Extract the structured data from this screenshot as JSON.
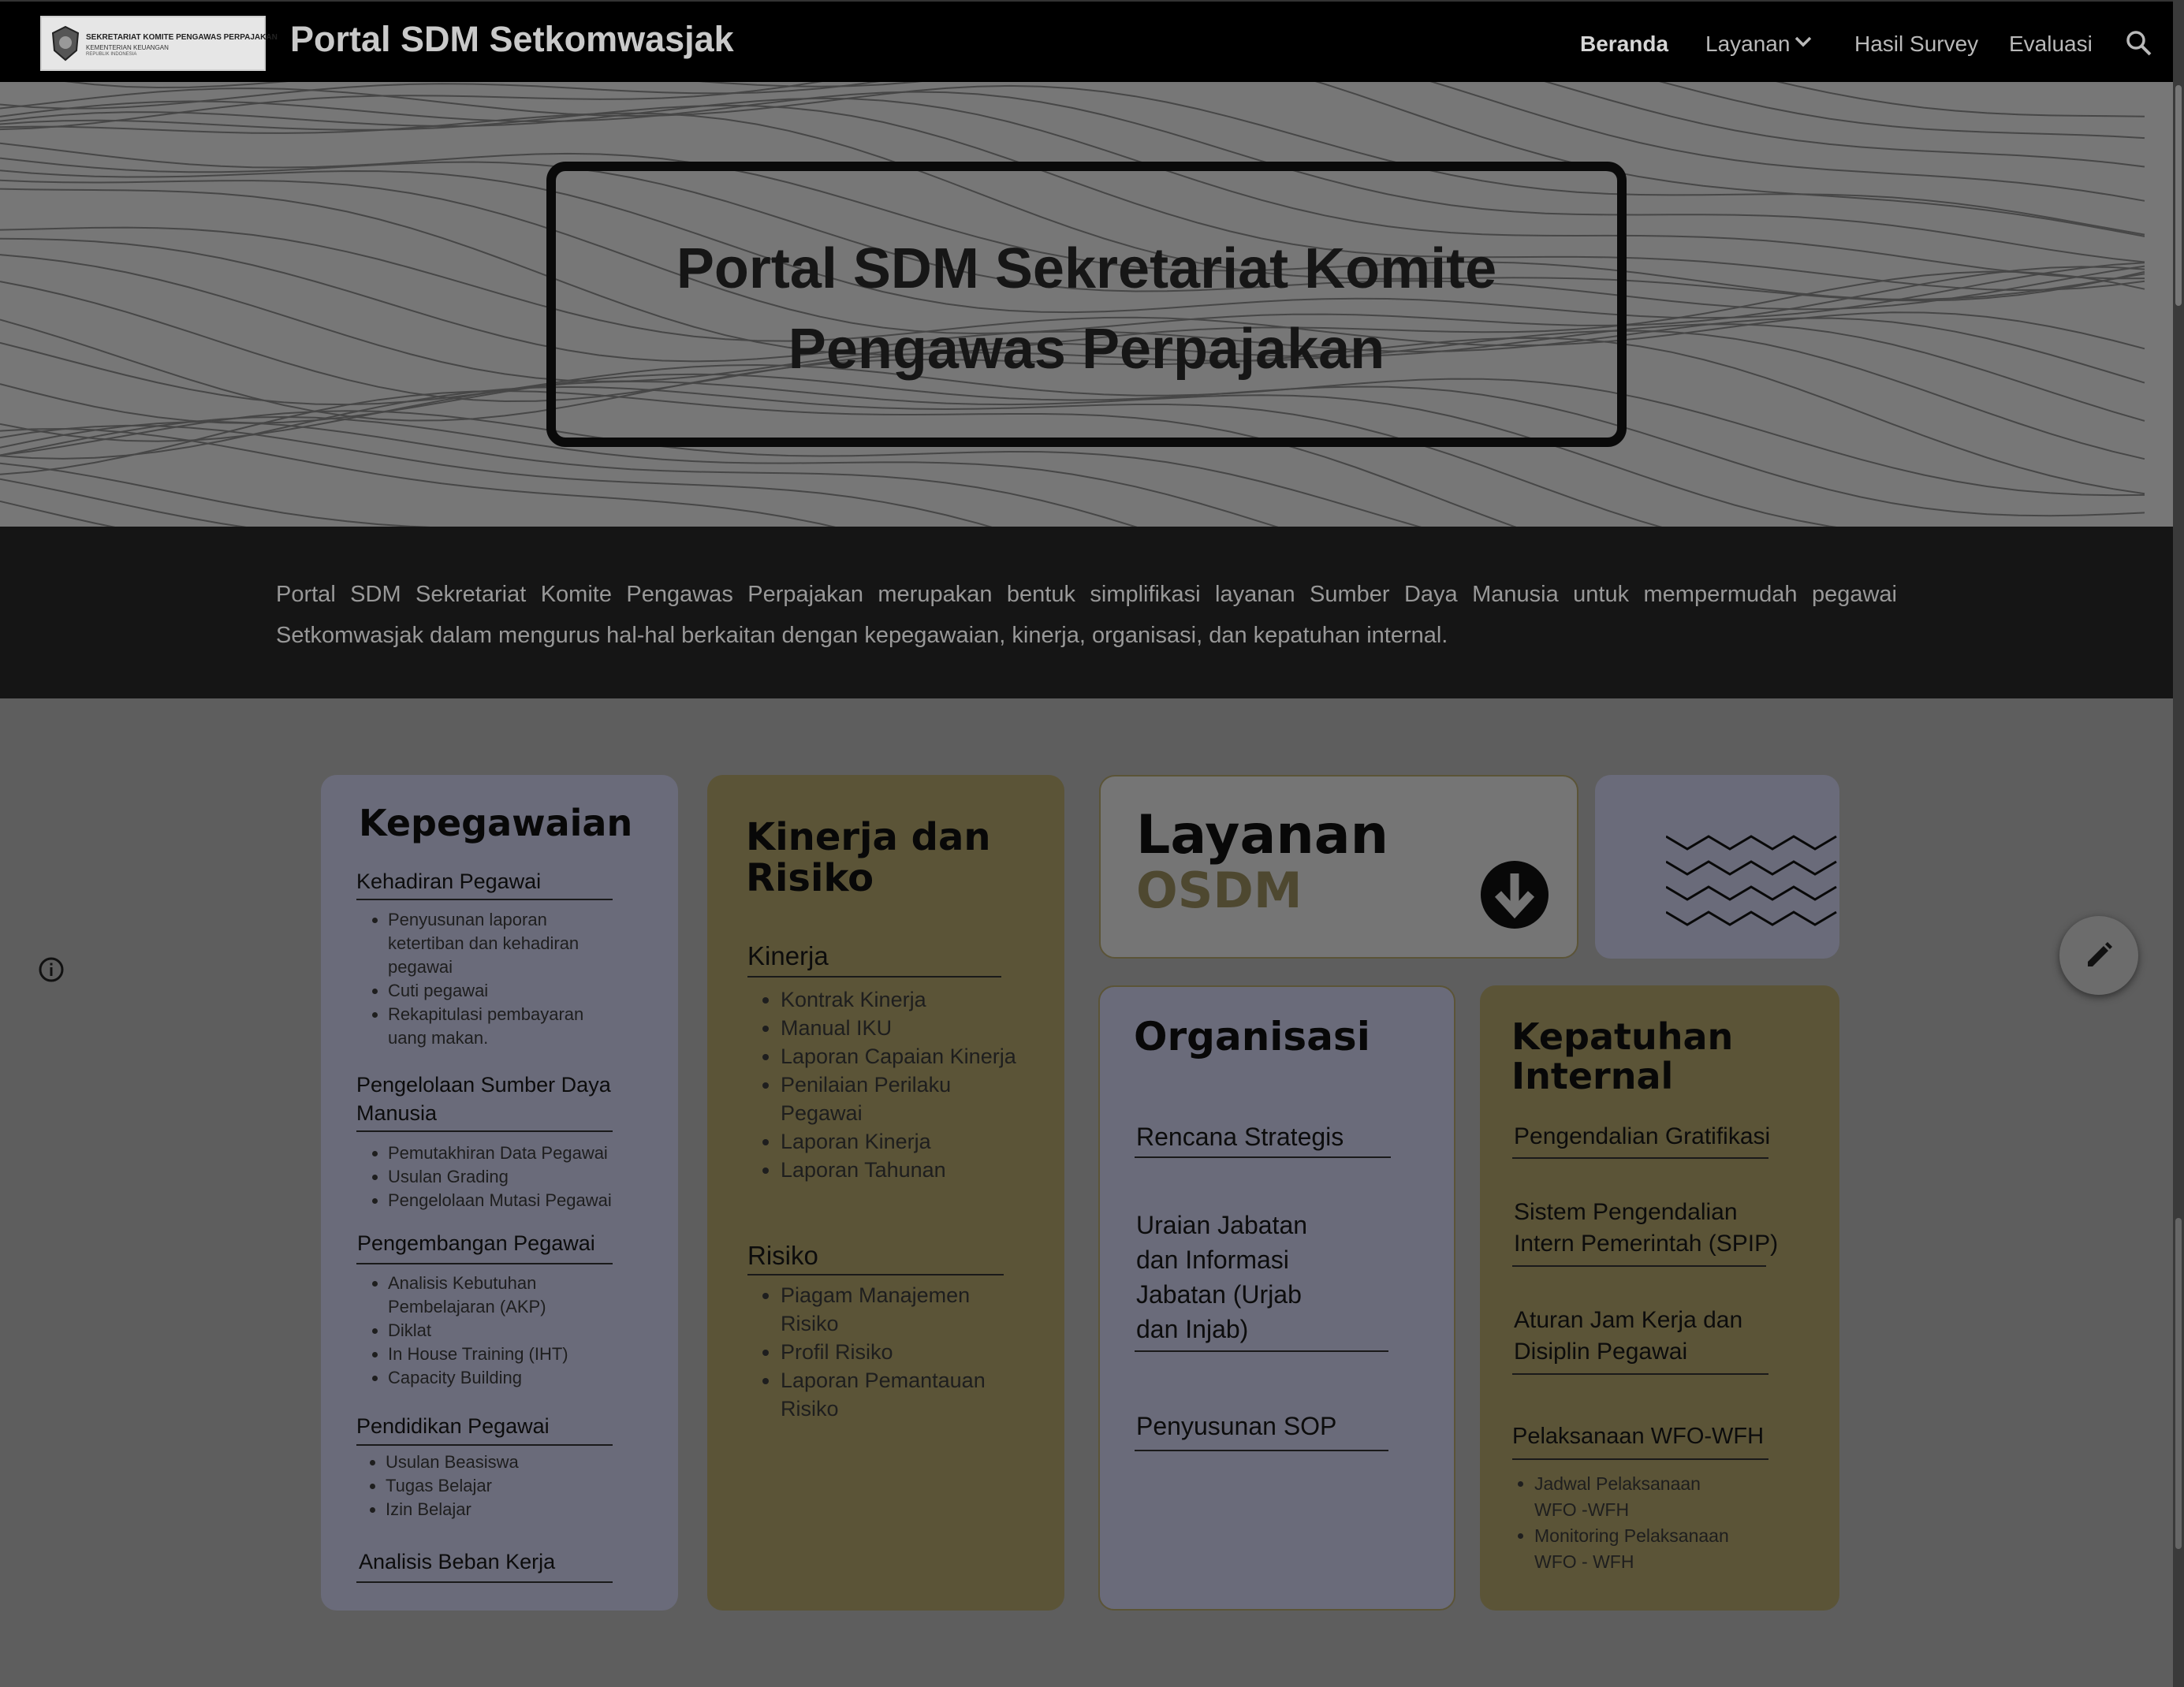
{
  "nav": {
    "logo_line1": "SEKRETARIAT KOMITE PENGAWAS PERPAJAKAN",
    "logo_line2": "KEMENTERIAN KEUANGAN",
    "logo_line3": "REPUBLIK INDONESIA",
    "site_title": "Portal SDM Setkomwasjak",
    "links": [
      "Beranda",
      "Layanan",
      "Hasil Survey",
      "Evaluasi"
    ],
    "active": "Beranda"
  },
  "hero": {
    "title_line1": "Portal SDM Sekretariat Komite",
    "title_line2": "Pengawas Perpajakan"
  },
  "intro": {
    "text": "Portal SDM Sekretariat Komite Pengawas Perpajakan merupakan bentuk simplifikasi layanan Sumber Daya Manusia untuk mempermudah pegawai Setkomwasjak dalam mengurus hal-hal berkaitan dengan kepegawaian, kinerja, organisasi, dan kepatuhan internal."
  },
  "kepegawaian": {
    "title": "Kepegawaian",
    "s1": {
      "title": "Kehadiran Pegawai",
      "items": [
        "Penyusunan laporan",
        "ketertiban dan kehadiran",
        "pegawai",
        "Cuti pegawai",
        "Rekapitulasi pembayaran",
        "uang makan."
      ]
    },
    "s2": {
      "title_1": "Pengelolaan Sumber Daya",
      "title_2": "Manusia",
      "items": [
        "Pemutakhiran Data Pegawai",
        "Usulan Grading",
        "Pengelolaan Mutasi Pegawai"
      ]
    },
    "s3": {
      "title": "Pengembangan Pegawai",
      "items": [
        "Analisis Kebutuhan",
        "Pembelajaran (AKP)",
        "Diklat",
        "In House Training (IHT)",
        "Capacity Building"
      ]
    },
    "s4": {
      "title": "Pendidikan Pegawai",
      "items": [
        "Usulan Beasiswa",
        "Tugas Belajar",
        "Izin Belajar"
      ]
    },
    "s5": {
      "title": "Analisis Beban Kerja"
    }
  },
  "kinerja": {
    "title_1": "Kinerja dan",
    "title_2": "Risiko",
    "s1": {
      "title": "Kinerja",
      "items": [
        "Kontrak Kinerja",
        "Manual IKU",
        "Laporan Capaian Kinerja",
        "Penilaian Perilaku",
        "Pegawai",
        "Laporan Kinerja",
        "Laporan Tahunan"
      ]
    },
    "s2": {
      "title": "Risiko",
      "items": [
        "Piagam Manajemen",
        "Risiko",
        "Profil Risiko",
        "Laporan Pemantauan",
        "Risiko"
      ]
    }
  },
  "layanan": {
    "word1": "Layanan",
    "word2": "OSDM"
  },
  "organisasi": {
    "title": "Organisasi",
    "item1": "Rencana Strategis",
    "item2": [
      "Uraian Jabatan",
      "dan Informasi",
      "Jabatan (Urjab",
      "dan Injab)"
    ],
    "item3": "Penyusunan SOP"
  },
  "kepatuhan": {
    "title_1": "Kepatuhan",
    "title_2": "Internal",
    "item1": "Pengendalian Gratifikasi",
    "item2": [
      "Sistem Pengendalian",
      "Intern Pemerintah (SPIP)"
    ],
    "item3": [
      "Aturan Jam Kerja dan",
      "Disiplin Pegawai"
    ],
    "item4": "Pelaksanaan WFO-WFH",
    "sub": [
      "Jadwal Pelaksanaan",
      "WFO -WFH",
      "Monitoring Pelaksanaan",
      "WFO - WFH"
    ]
  },
  "icons": {
    "search": "search-icon",
    "chevron": "chevron-down-icon",
    "info": "info-icon",
    "edit": "pencil-icon",
    "arrow": "arrow-down-circle-icon"
  },
  "colors": {
    "card_blue": "#6a6b7a",
    "card_olive": "#5b5437",
    "nav_bg": "#000000",
    "band_bg": "#151515"
  }
}
